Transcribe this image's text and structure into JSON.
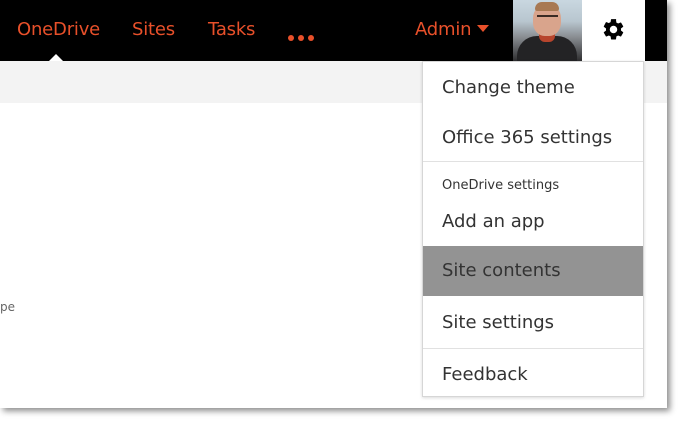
{
  "topbar": {
    "nav": [
      {
        "label": "OneDrive",
        "active": true
      },
      {
        "label": "Sites"
      },
      {
        "label": "Tasks"
      }
    ],
    "more_icon": "ellipsis-icon",
    "user_menu_label": "Admin",
    "settings_icon": "gear-icon",
    "accent_color": "#e8502a"
  },
  "page": {
    "fragment_text": "pe"
  },
  "settings_menu": {
    "items_top": [
      "Change theme",
      "Office 365 settings"
    ],
    "section_label": "OneDrive settings",
    "items_section": [
      "Add an app",
      "Site contents",
      "Site settings"
    ],
    "items_bottom": [
      "Feedback"
    ],
    "selected_item": "Site contents",
    "selected_color": "#939393"
  }
}
